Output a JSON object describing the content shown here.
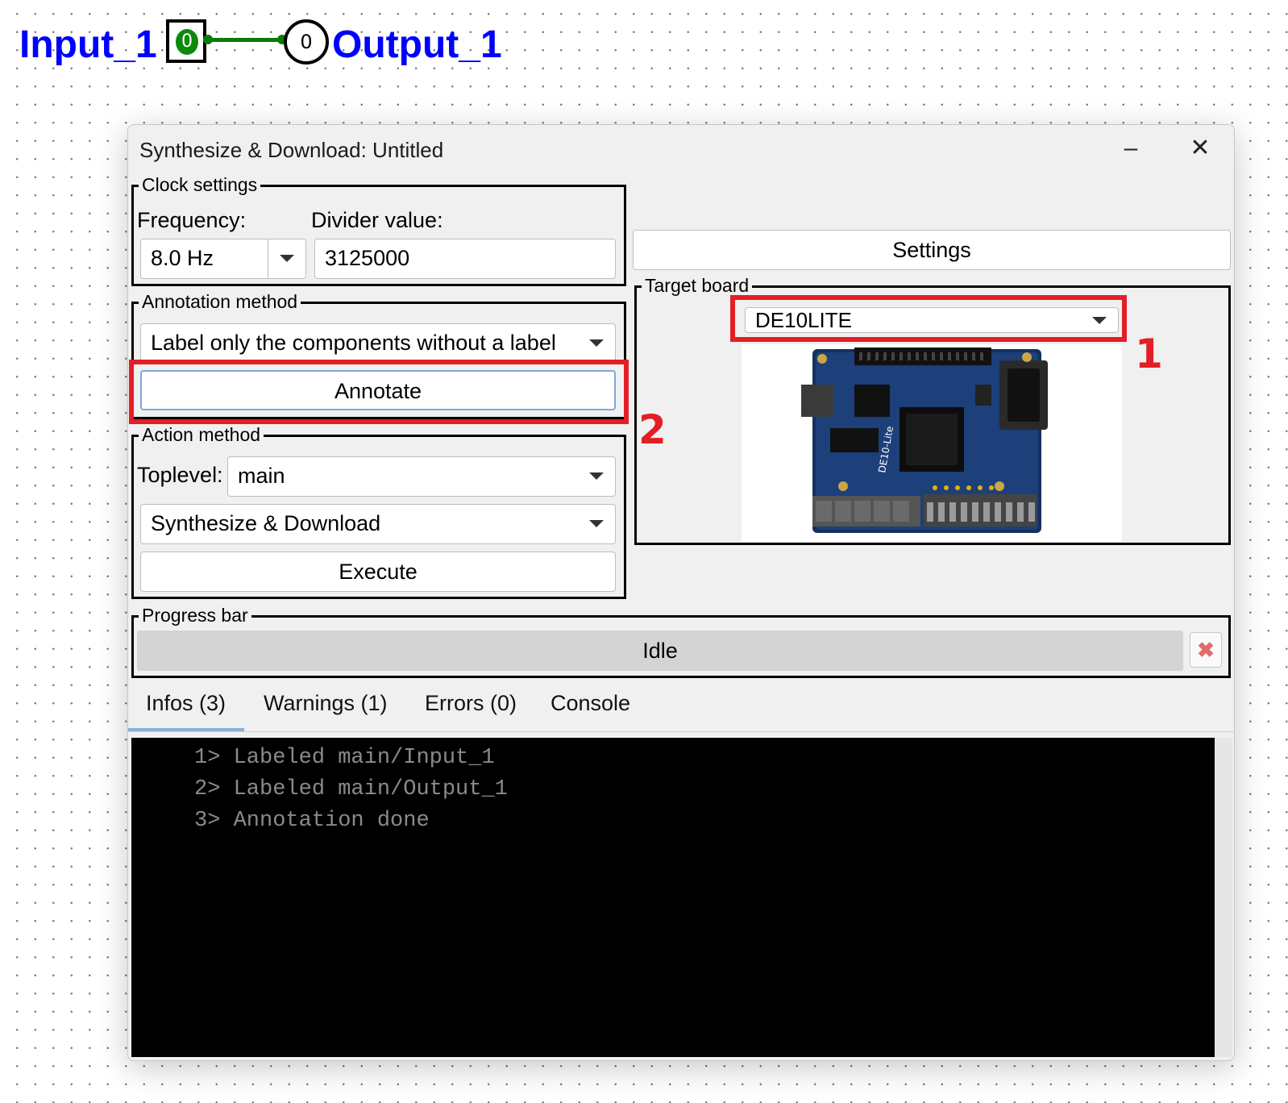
{
  "circuit": {
    "input_label": "Input_1",
    "input_value": "0",
    "output_label": "Output_1",
    "output_value": "0"
  },
  "dialog": {
    "title": "Synthesize & Download: Untitled",
    "minimize_symbol": "–",
    "close_symbol": "✕",
    "clock_settings": {
      "group_label": "Clock settings",
      "frequency_label": "Frequency:",
      "frequency_value": "8.0 Hz",
      "divider_label": "Divider value:",
      "divider_value": "3125000"
    },
    "annotation": {
      "group_label": "Annotation method",
      "method_value": "Label only the components without a label",
      "annotate_button": "Annotate"
    },
    "action": {
      "group_label": "Action method",
      "toplevel_label": "Toplevel:",
      "toplevel_value": "main",
      "action_value": "Synthesize & Download",
      "execute_button": "Execute"
    },
    "settings_button": "Settings",
    "target_board": {
      "group_label": "Target board",
      "board_value": "DE10LITE",
      "board_silkscreen": "DE10-Lite"
    },
    "progress": {
      "group_label": "Progress bar",
      "status_text": "Idle",
      "cancel_symbol": "✖"
    },
    "tabs": [
      {
        "label": "Infos (3)",
        "active": true
      },
      {
        "label": "Warnings (1)",
        "active": false
      },
      {
        "label": "Errors (0)",
        "active": false
      },
      {
        "label": "Console",
        "active": false
      }
    ],
    "console_lines": [
      "1> Labeled main/Input_1",
      "2> Labeled main/Output_1",
      "3> Annotation done"
    ]
  },
  "callouts": {
    "first": "1",
    "second": "2",
    "color": "#e41e26"
  }
}
